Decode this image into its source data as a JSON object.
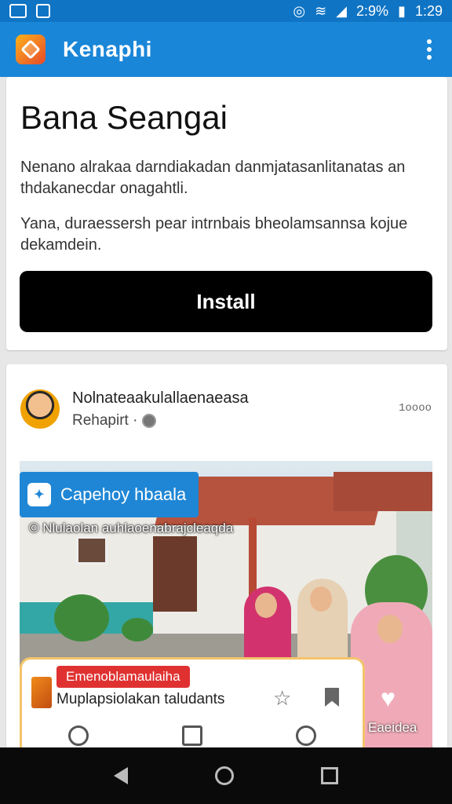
{
  "status_bar": {
    "battery": "2:9%",
    "time": "1:29"
  },
  "appbar": {
    "title": "Kenaphi"
  },
  "install_card": {
    "title": "Bana Seangai",
    "paragraph1": "Nenano alrakaa darndiakadan danmjatasanlitanatas an thdakanecdar onagahtli.",
    "paragraph2": "Yana, duraessersh pear intrnbais bheolamsannsa kojue dekamdein.",
    "install_label": "Install"
  },
  "post": {
    "name": "Nolnateaakulallaenaeasa",
    "sub": "Rehapirt ·",
    "time": "1oooo",
    "photo": {
      "badge_label": "Capehoy hbaala",
      "caption": "© Nlulaolan auhlaoenabrajcleaqda",
      "inner_card": {
        "tag": "Emenoblamaulaiha",
        "title": "Muplapsiolakan taludants"
      },
      "bottom_label": "Eaeidea"
    }
  },
  "colors": {
    "status_bar": "#0f74c4",
    "app_bar": "#1a86d8",
    "install_button": "#000000",
    "tag_red": "#e03131"
  }
}
